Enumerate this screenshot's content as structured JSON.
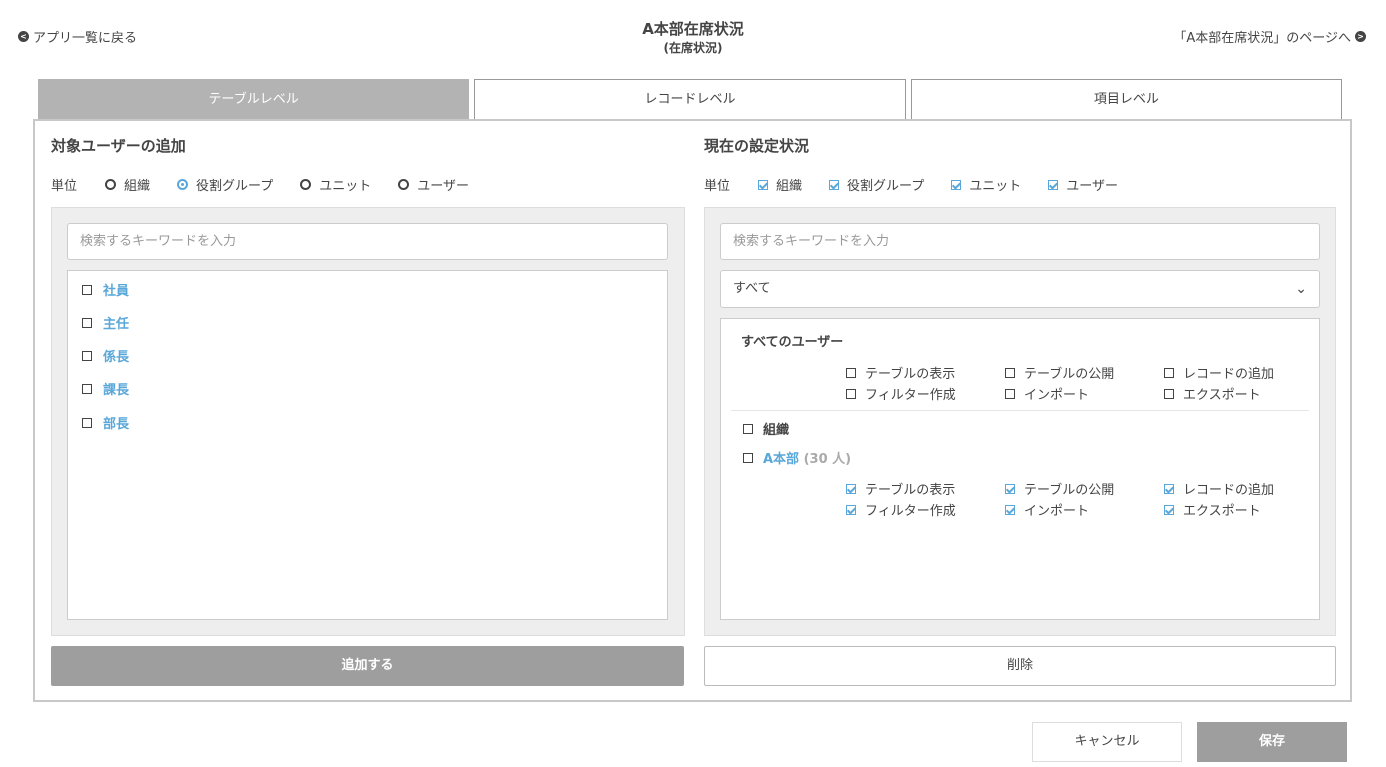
{
  "header": {
    "back_label": "アプリ一覧に戻る",
    "title": "A本部在席状況",
    "subtitle": "(在席状況)",
    "forward_label": "「A本部在席状況」のページへ"
  },
  "tabs": [
    {
      "label": "テーブルレベル",
      "active": true
    },
    {
      "label": "レコードレベル",
      "active": false
    },
    {
      "label": "項目レベル",
      "active": false
    }
  ],
  "left": {
    "title": "対象ユーザーの追加",
    "unit_label": "単位",
    "units": [
      {
        "label": "組織",
        "selected": false
      },
      {
        "label": "役割グループ",
        "selected": true
      },
      {
        "label": "ユニット",
        "selected": false
      },
      {
        "label": "ユーザー",
        "selected": false
      }
    ],
    "search_placeholder": "検索するキーワードを入力",
    "items": [
      "社員",
      "主任",
      "係長",
      "課長",
      "部長"
    ],
    "add_button": "追加する"
  },
  "right": {
    "title": "現在の設定状況",
    "unit_label": "単位",
    "units": [
      {
        "label": "組織",
        "checked": true
      },
      {
        "label": "役割グループ",
        "checked": true
      },
      {
        "label": "ユニット",
        "checked": true
      },
      {
        "label": "ユーザー",
        "checked": true
      }
    ],
    "search_placeholder": "検索するキーワードを入力",
    "filter_value": "すべて",
    "all_users_title": "すべてのユーザー",
    "all_users_perms": [
      {
        "label": "テーブルの表示",
        "checked": false
      },
      {
        "label": "テーブルの公開",
        "checked": false
      },
      {
        "label": "レコードの追加",
        "checked": false
      },
      {
        "label": "フィルター作成",
        "checked": false
      },
      {
        "label": "インポート",
        "checked": false
      },
      {
        "label": "エクスポート",
        "checked": false
      }
    ],
    "org_group_label": "組織",
    "org_name": "A本部",
    "org_count": "(30 人)",
    "org_perms": [
      {
        "label": "テーブルの表示",
        "checked": true
      },
      {
        "label": "テーブルの公開",
        "checked": true
      },
      {
        "label": "レコードの追加",
        "checked": true
      },
      {
        "label": "フィルター作成",
        "checked": true
      },
      {
        "label": "インポート",
        "checked": true
      },
      {
        "label": "エクスポート",
        "checked": true
      }
    ],
    "delete_button": "削除"
  },
  "footer": {
    "cancel_label": "キャンセル",
    "save_label": "保存"
  },
  "colors": {
    "accent": "#5aa7d9",
    "button_gray": "#9e9e9e",
    "active_tab": "#b3b3b3"
  }
}
